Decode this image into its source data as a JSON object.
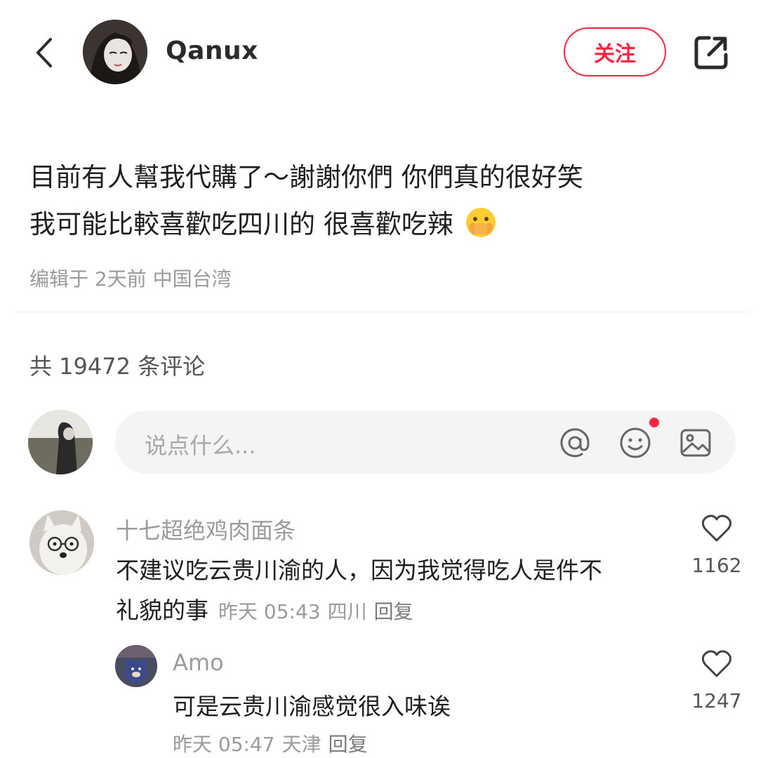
{
  "header": {
    "author_name": "Qanux",
    "follow_label": "关注",
    "icons": [
      "back-icon",
      "share-icon"
    ]
  },
  "post": {
    "line1": "目前有人幫我代購了～謝謝你們 你們真的很好笑",
    "line2": "我可能比較喜歡吃四川的  很喜歡吃辣",
    "emoji": "hand-over-mouth-emoji",
    "meta": "编辑于 2天前 中国台湾"
  },
  "comments_section": {
    "count_label": "共 19472 条评论",
    "input_placeholder": "说点什么...",
    "input_icons": [
      "at-icon",
      "emoji-icon",
      "image-icon"
    ],
    "accent_color": "#ff2442"
  },
  "comments": [
    {
      "author": "十七超绝鸡肉面条",
      "text_line1": "不建议吃云贵川渝的人，因为我觉得吃人是件不",
      "text_line2": "礼貌的事",
      "time": "昨天 05:43",
      "location": "四川",
      "reply_label": "回复",
      "likes": "1162"
    },
    {
      "author": "Amo",
      "text": "可是云贵川渝感觉很入味诶",
      "time": "昨天 05:47",
      "location": "天津",
      "reply_label": "回复",
      "likes": "1247"
    }
  ]
}
